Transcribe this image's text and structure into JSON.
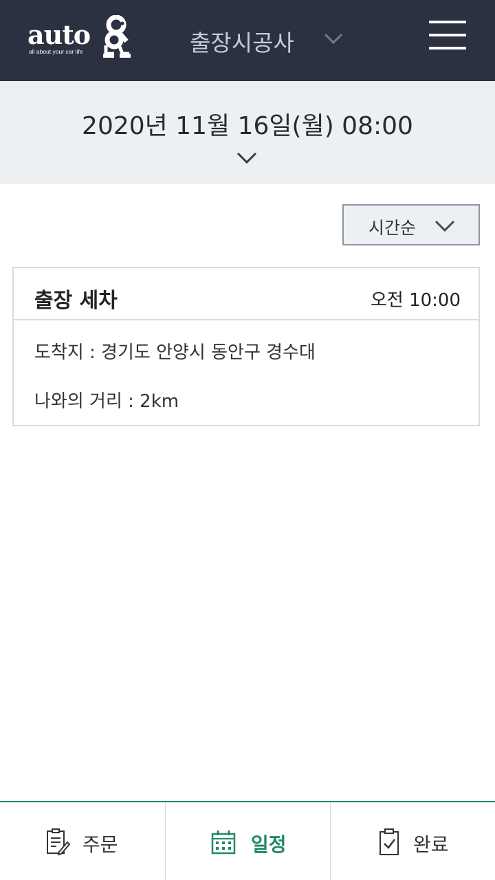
{
  "header": {
    "logo_text": "auto",
    "logo_tagline": "all about your car life",
    "title": "출장시공사",
    "title_icon": "chevron-down-icon",
    "menu_icon": "hamburger-menu-icon"
  },
  "date_selector": {
    "value": "2020년  11월  16일(월)  08:00",
    "icon": "chevron-down-icon"
  },
  "sort": {
    "label": "시간순",
    "icon": "chevron-down-icon"
  },
  "schedule": [
    {
      "title": "출장 세차",
      "time": "오전  10:00",
      "destination": "도착지 : 경기도 안양시 동안구 경수대",
      "distance": "나와의 거리 : 2km"
    }
  ],
  "tabs": [
    {
      "label": "주문",
      "icon": "order-form-icon",
      "active": false
    },
    {
      "label": "일정",
      "icon": "calendar-icon",
      "active": true
    },
    {
      "label": "완료",
      "icon": "clipboard-check-icon",
      "active": false
    }
  ],
  "colors": {
    "header_bg": "#2b3141",
    "date_bar_bg": "#edf0f3",
    "accent_green": "#1f8a63",
    "border": "#d8dce0"
  }
}
